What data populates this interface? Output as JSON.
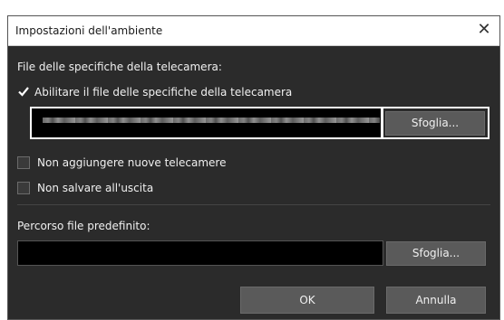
{
  "dialog": {
    "title": "Impostazioni dell'ambiente",
    "close_glyph": "✕"
  },
  "camera_spec": {
    "section_label": "File delle specifiche della telecamera:",
    "enable_checkbox_label": "Abilitare il file delle specifiche della telecamera",
    "enable_checked": true,
    "browse_label": "Sfoglia..."
  },
  "options": {
    "no_new_cameras_label": "Non aggiungere nuove telecamere",
    "no_new_cameras_checked": false,
    "no_save_on_exit_label": "Non salvare all'uscita",
    "no_save_on_exit_checked": false
  },
  "default_path": {
    "label": "Percorso file predefinito:",
    "value": "",
    "browse_label": "Sfoglia..."
  },
  "footer": {
    "ok_label": "OK",
    "cancel_label": "Annulla"
  }
}
